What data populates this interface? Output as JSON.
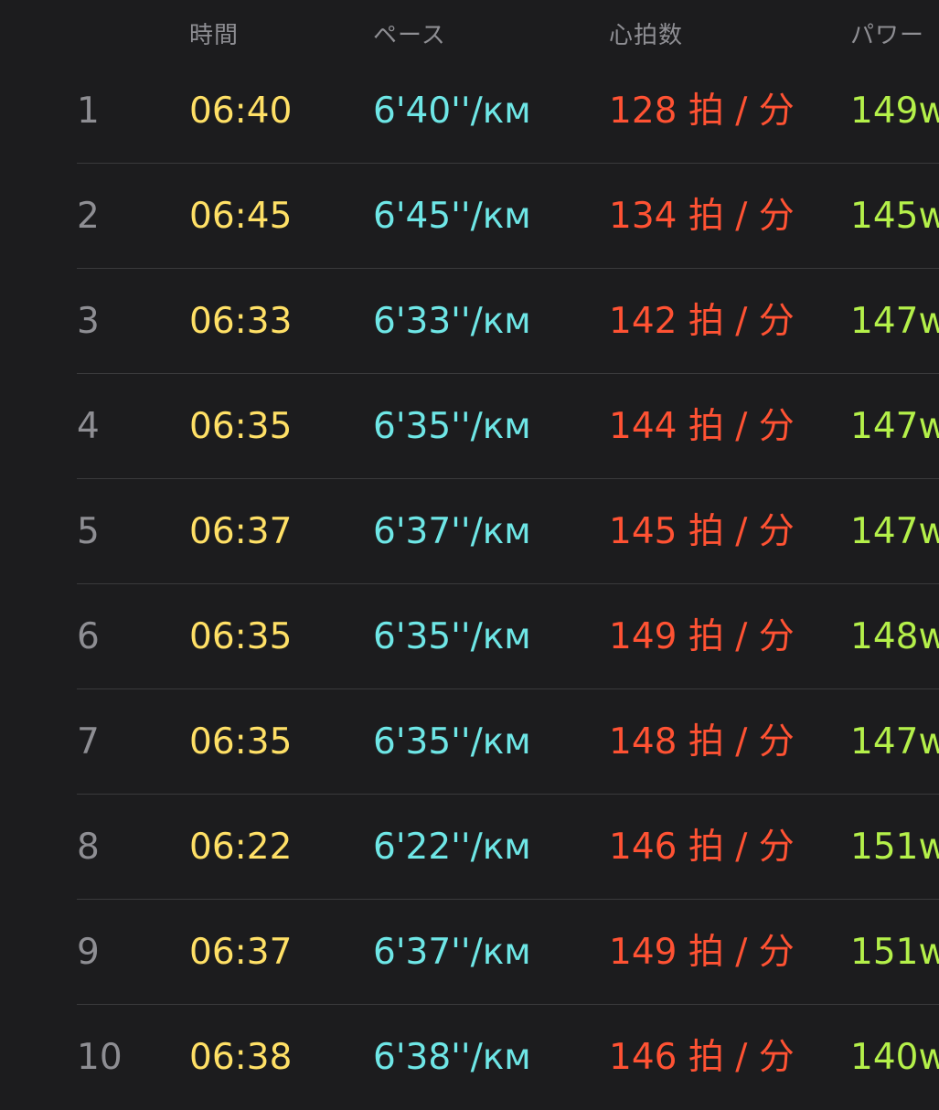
{
  "header": {
    "columns": [
      "時間",
      "ペース",
      "心拍数",
      "パワー"
    ]
  },
  "rows": [
    {
      "index": "1",
      "time": "06:40",
      "pace": "6'40''/км",
      "heart_rate": "128 拍 / 分",
      "power": "149w"
    },
    {
      "index": "2",
      "time": "06:45",
      "pace": "6'45''/км",
      "heart_rate": "134 拍 / 分",
      "power": "145w"
    },
    {
      "index": "3",
      "time": "06:33",
      "pace": "6'33''/км",
      "heart_rate": "142 拍 / 分",
      "power": "147w"
    },
    {
      "index": "4",
      "time": "06:35",
      "pace": "6'35''/км",
      "heart_rate": "144 拍 / 分",
      "power": "147w"
    },
    {
      "index": "5",
      "time": "06:37",
      "pace": "6'37''/км",
      "heart_rate": "145 拍 / 分",
      "power": "147w"
    },
    {
      "index": "6",
      "time": "06:35",
      "pace": "6'35''/км",
      "heart_rate": "149 拍 / 分",
      "power": "148w"
    },
    {
      "index": "7",
      "time": "06:35",
      "pace": "6'35''/км",
      "heart_rate": "148 拍 / 分",
      "power": "147w"
    },
    {
      "index": "8",
      "time": "06:22",
      "pace": "6'22''/км",
      "heart_rate": "146 拍 / 分",
      "power": "151w"
    },
    {
      "index": "9",
      "time": "06:37",
      "pace": "6'37''/км",
      "heart_rate": "149 拍 / 分",
      "power": "151w"
    },
    {
      "index": "10",
      "time": "06:38",
      "pace": "6'38''/км",
      "heart_rate": "146 拍 / 分",
      "power": "140w"
    }
  ],
  "colors": {
    "background": "#1c1c1e",
    "index": "#8e8e93",
    "time": "#ffe066",
    "pace": "#6ee6e6",
    "heart_rate": "#ff5233",
    "power": "#b4f04a"
  }
}
